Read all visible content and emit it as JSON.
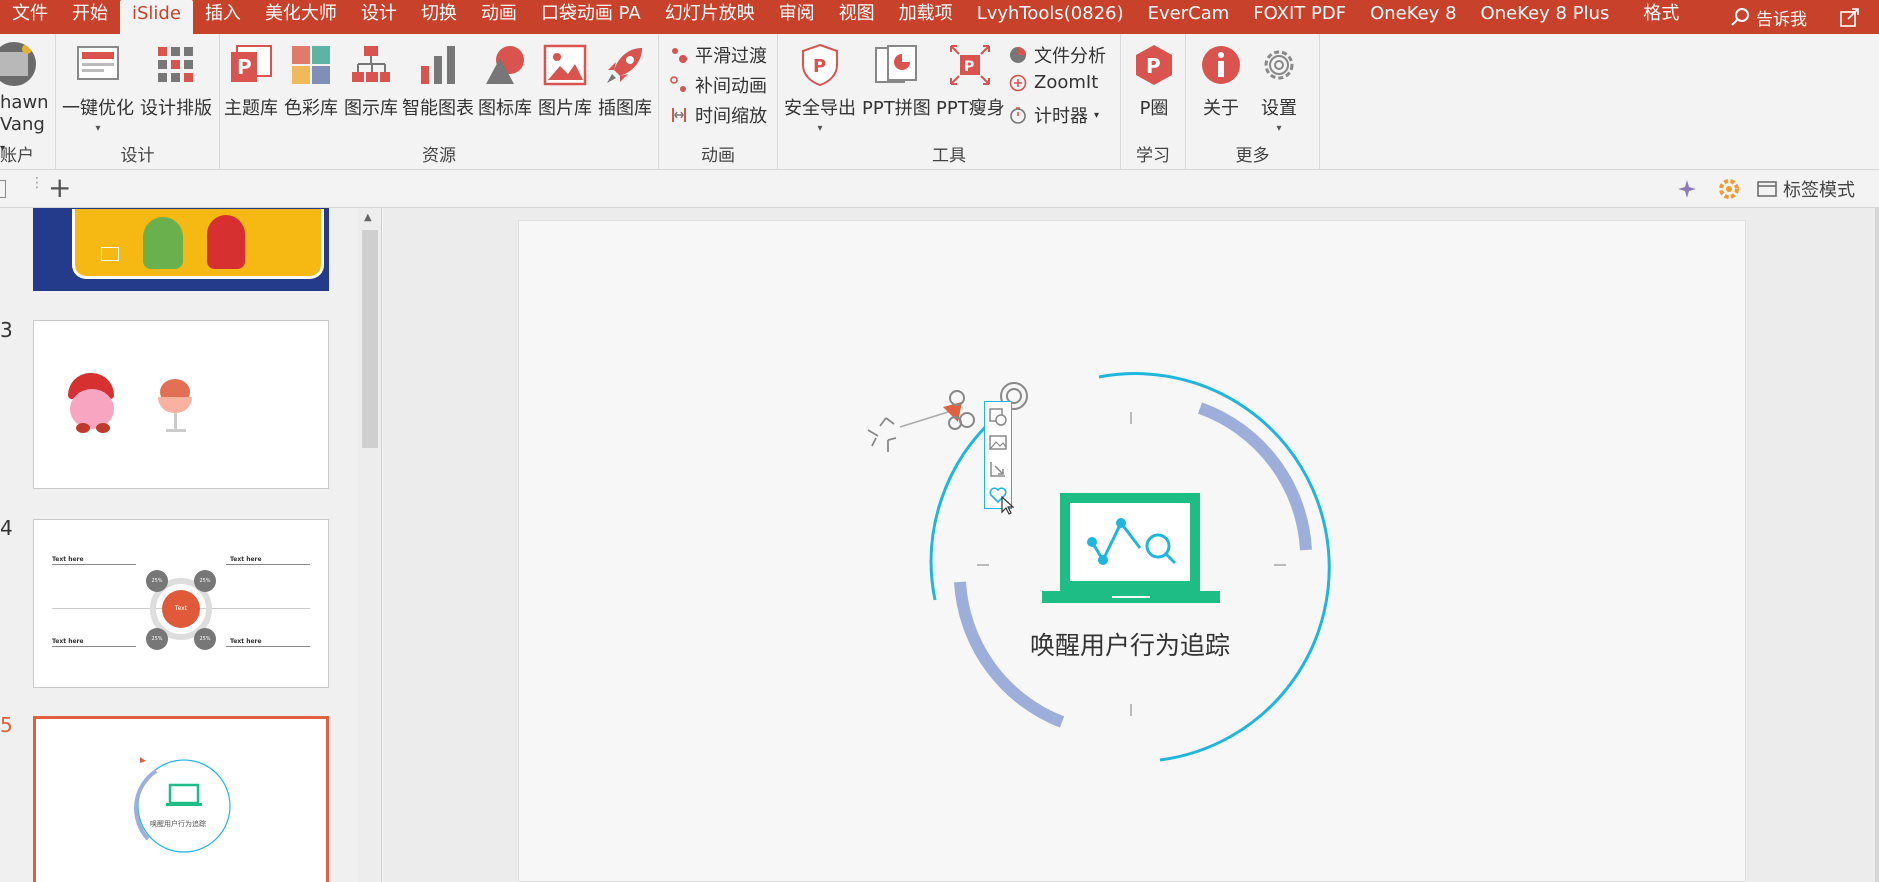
{
  "tabs": [
    "文件",
    "开始",
    "iSlide",
    "插入",
    "美化大师",
    "设计",
    "切换",
    "动画",
    "口袋动画 PA",
    "幻灯片放映",
    "审阅",
    "视图",
    "加载项",
    "LvyhTools(0826)",
    "EverCam",
    "FOXIT PDF",
    "OneKey 8",
    "OneKey 8 Plus",
    "格式"
  ],
  "active_tab": "iSlide",
  "tell_me": "告诉我",
  "colors": {
    "accent": "#c8412b",
    "slide_selected": "#e0603f",
    "circle_blue": "#1eb6dc",
    "arc_gray": "#9eaedb",
    "laptop_green": "#1dbd85"
  },
  "ribbon": {
    "account": {
      "name_line1": "hawn",
      "name_line2": "Vang",
      "label": "账户"
    },
    "design": {
      "label": "设计",
      "one_click": "一键优化",
      "layout": "设计排版"
    },
    "resources": {
      "label": "资源",
      "items": [
        "主题库",
        "色彩库",
        "图示库",
        "智能图表",
        "图标库",
        "图片库",
        "插图库"
      ]
    },
    "animation": {
      "label": "动画",
      "items": [
        "平滑过渡",
        "补间动画",
        "时间缩放"
      ]
    },
    "tools": {
      "label": "工具",
      "export": "安全导出",
      "collage": "PPT拼图",
      "slim": "PPT瘦身",
      "file_analysis": "文件分析",
      "zoomit": "ZoomIt",
      "timer": "计时器"
    },
    "learn": {
      "label": "学习",
      "pcircle": "P圈"
    },
    "more": {
      "label": "更多",
      "about": "关于",
      "settings": "设置"
    }
  },
  "quickbar": {
    "tab_mode": "标签模式"
  },
  "slides": [
    {
      "number": "3"
    },
    {
      "number": "4",
      "texts": [
        "Text here",
        "Text here",
        "Text here",
        "Text here"
      ],
      "center": "Text",
      "pcts": [
        "25%",
        "25%",
        "25%",
        "25%"
      ]
    },
    {
      "number": "5",
      "caption": "唤醒用户行为追踪"
    }
  ],
  "slide_main": {
    "title": "唤醒用户行为追踪"
  }
}
